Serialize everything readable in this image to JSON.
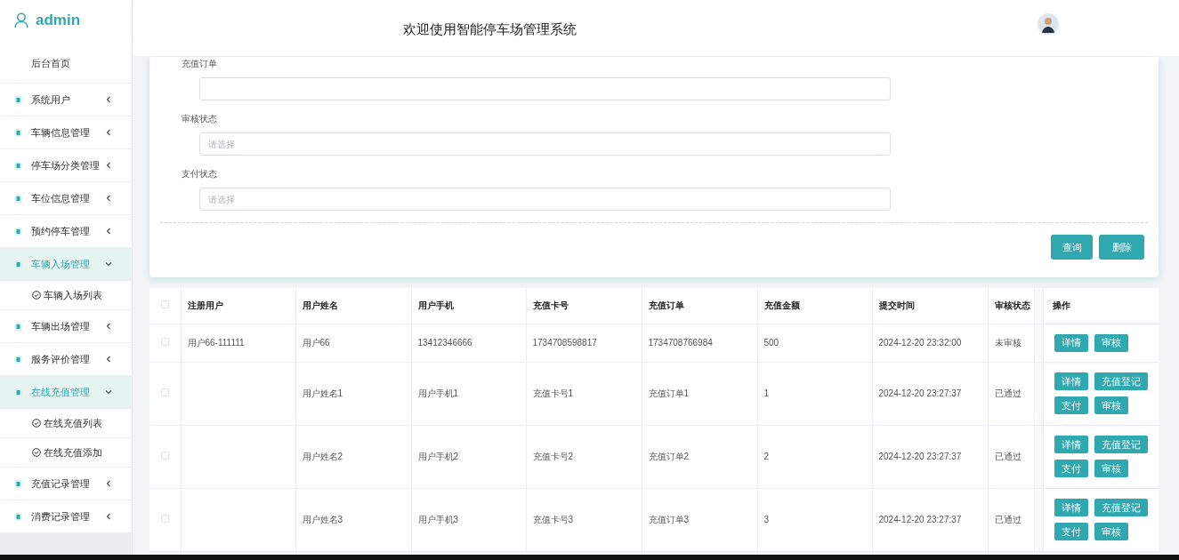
{
  "sidebar": {
    "user": "admin",
    "items": [
      {
        "kind": "home",
        "label": "后台首页"
      },
      {
        "kind": "menu",
        "label": "系统用户",
        "expanded": false
      },
      {
        "kind": "menu",
        "label": "车辆信息管理",
        "expanded": false
      },
      {
        "kind": "menu",
        "label": "停车场分类管理",
        "expanded": false
      },
      {
        "kind": "menu",
        "label": "车位信息管理",
        "expanded": false
      },
      {
        "kind": "menu",
        "label": "预约停车管理",
        "expanded": false
      },
      {
        "kind": "menu",
        "label": "车辆入场管理",
        "expanded": true,
        "children": [
          {
            "label": "车辆入场列表"
          }
        ]
      },
      {
        "kind": "menu",
        "label": "车辆出场管理",
        "expanded": false
      },
      {
        "kind": "menu",
        "label": "服务评价管理",
        "expanded": false
      },
      {
        "kind": "menu",
        "label": "在线充值管理",
        "expanded": true,
        "children": [
          {
            "label": "在线充值列表"
          },
          {
            "label": "在线充值添加"
          }
        ]
      },
      {
        "kind": "menu",
        "label": "充值记录管理",
        "expanded": false
      },
      {
        "kind": "menu",
        "label": "消费记录管理",
        "expanded": false
      }
    ]
  },
  "header": {
    "title": "欢迎使用智能停车场管理系统"
  },
  "search_form": {
    "fields": [
      {
        "label": "充值订单"
      },
      {
        "label": "审核状态",
        "placeholder": "请选择"
      },
      {
        "label": "支付状态",
        "placeholder": "请选择"
      }
    ],
    "buttons": [
      "查询",
      "删除"
    ]
  },
  "table": {
    "header_checked": false,
    "columns": [
      "注册用户",
      "用户姓名",
      "用户手机",
      "充值卡号",
      "充值订单",
      "充值金额",
      "提交时间",
      "审核状态",
      "操作"
    ],
    "rows": [
      {
        "checked": false,
        "cells": [
          "用户66-111111",
          "用户66",
          "13412346666",
          "1734708598817",
          "1734708766984",
          "500",
          "2024-12-20 23:32:00",
          "未审核"
        ],
        "actions": [
          "详情",
          "审核"
        ]
      },
      {
        "checked": false,
        "cells": [
          "",
          "用户姓名1",
          "用户手机1",
          "充值卡号1",
          "充值订单1",
          "1",
          "2024-12-20 23:27:37",
          "已通过"
        ],
        "actions": [
          "详情",
          "充值登记",
          "支付",
          "审核"
        ]
      },
      {
        "checked": false,
        "cells": [
          "",
          "用户姓名2",
          "用户手机2",
          "充值卡号2",
          "充值订单2",
          "2",
          "2024-12-20 23:27:37",
          "已通过"
        ],
        "actions": [
          "详情",
          "充值登记",
          "支付",
          "审核"
        ]
      },
      {
        "checked": false,
        "cells": [
          "",
          "用户姓名3",
          "用户手机3",
          "充值卡号3",
          "充值订单3",
          "3",
          "2024-12-20 23:27:37",
          "已通过"
        ],
        "actions": [
          "详情",
          "充值登记",
          "支付",
          "审核"
        ]
      }
    ]
  }
}
